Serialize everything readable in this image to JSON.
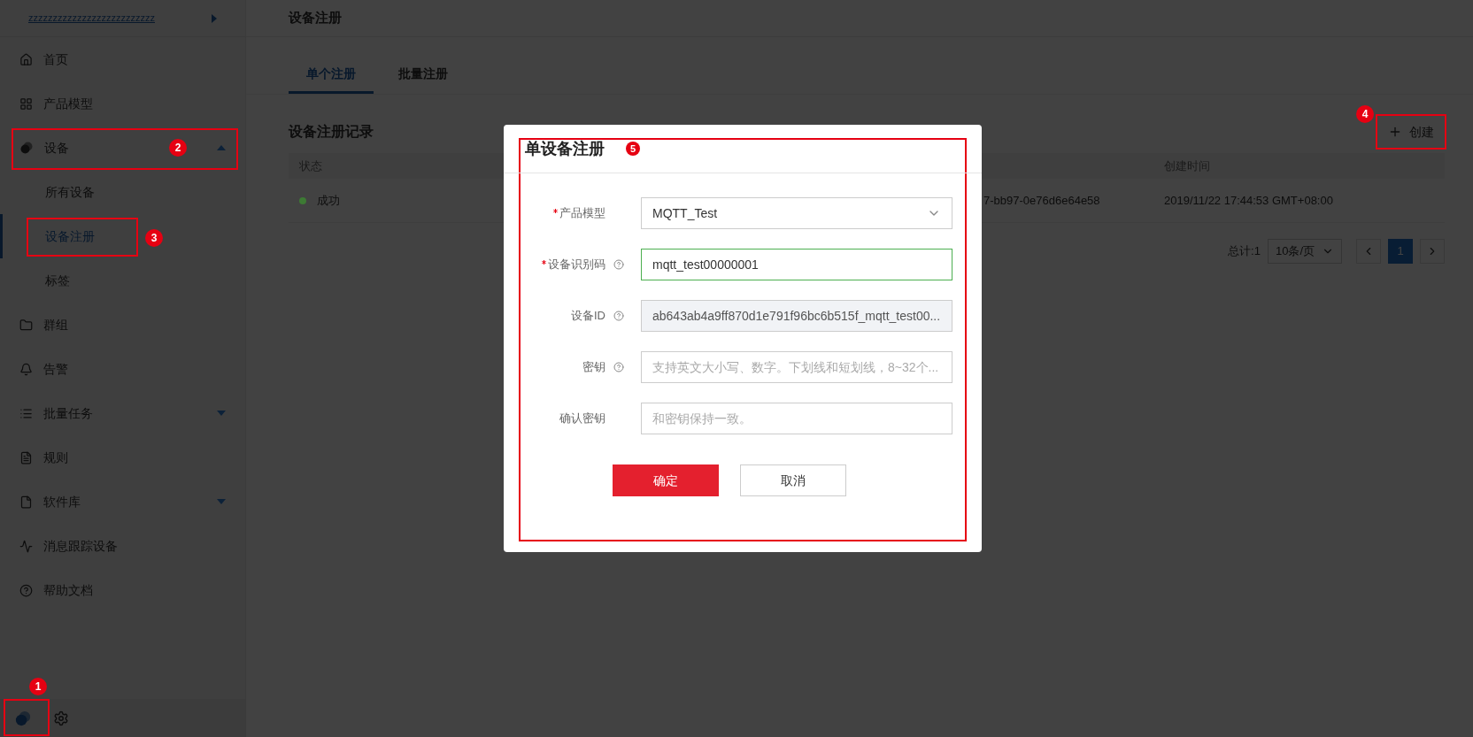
{
  "sidebar": {
    "project": "zzzzzzzzzzzzzzzzzzzzzzzzzz",
    "items": [
      {
        "label": "首页",
        "expanded": false
      },
      {
        "label": "产品模型",
        "expanded": false
      },
      {
        "label": "设备",
        "expanded": true,
        "callout": "2",
        "children": [
          {
            "label": "所有设备",
            "selected": false
          },
          {
            "label": "设备注册",
            "selected": true,
            "callout": "3"
          },
          {
            "label": "标签",
            "selected": false
          }
        ]
      },
      {
        "label": "群组",
        "expanded": false
      },
      {
        "label": "告警",
        "expanded": false
      },
      {
        "label": "批量任务",
        "expanded": false,
        "expandable": true
      },
      {
        "label": "规则",
        "expanded": false
      },
      {
        "label": "软件库",
        "expanded": false,
        "expandable": true
      },
      {
        "label": "消息跟踪设备",
        "expanded": false
      },
      {
        "label": "帮助文档",
        "expanded": false
      }
    ],
    "footer_callout": "1"
  },
  "page": {
    "title": "设备注册",
    "tabs": [
      {
        "label": "单个注册",
        "selected": true
      },
      {
        "label": "批量注册",
        "selected": false
      }
    ],
    "section_title": "设备注册记录",
    "create_button": {
      "label": "创建",
      "callout": "4"
    },
    "table": {
      "columns": [
        "状态",
        "",
        "",
        "创建时间"
      ],
      "rows": [
        {
          "status": "成功",
          "color": "#3d7a34",
          "column_3": "7-bb97-0e76d6e64e58",
          "created": "2019/11/22 17:44:53 GMT+08:00"
        }
      ]
    },
    "pagination": {
      "total": "总计:1",
      "page_size": "10条/页",
      "pages": [
        {
          "label": "1",
          "selected": true
        }
      ]
    }
  },
  "dialog": {
    "title": "单设备注册",
    "callout": "5",
    "fields": [
      {
        "kind": "select",
        "label": "产品模型",
        "required": true,
        "help": false,
        "value": "MQTT_Test",
        "valid": false
      },
      {
        "kind": "text",
        "label": "设备识别码",
        "required": true,
        "help": true,
        "value": "mqtt_test00000001",
        "valid": true
      },
      {
        "kind": "readonly",
        "label": "设备ID",
        "required": false,
        "help": true,
        "value": "ab643ab4a9ff870d1e791f96bc6b515f_mqtt_test00...",
        "valid": false
      },
      {
        "kind": "text",
        "label": "密钥",
        "required": false,
        "help": true,
        "placeholder": "支持英文大小写、数字。下划线和短划线，8~32个...",
        "valid": false
      },
      {
        "kind": "text",
        "label": "确认密钥",
        "required": false,
        "help": false,
        "placeholder": "和密钥保持一致。",
        "valid": false
      }
    ],
    "buttons": [
      {
        "label": "确定",
        "primary": true
      },
      {
        "label": "取消",
        "primary": false
      }
    ]
  }
}
